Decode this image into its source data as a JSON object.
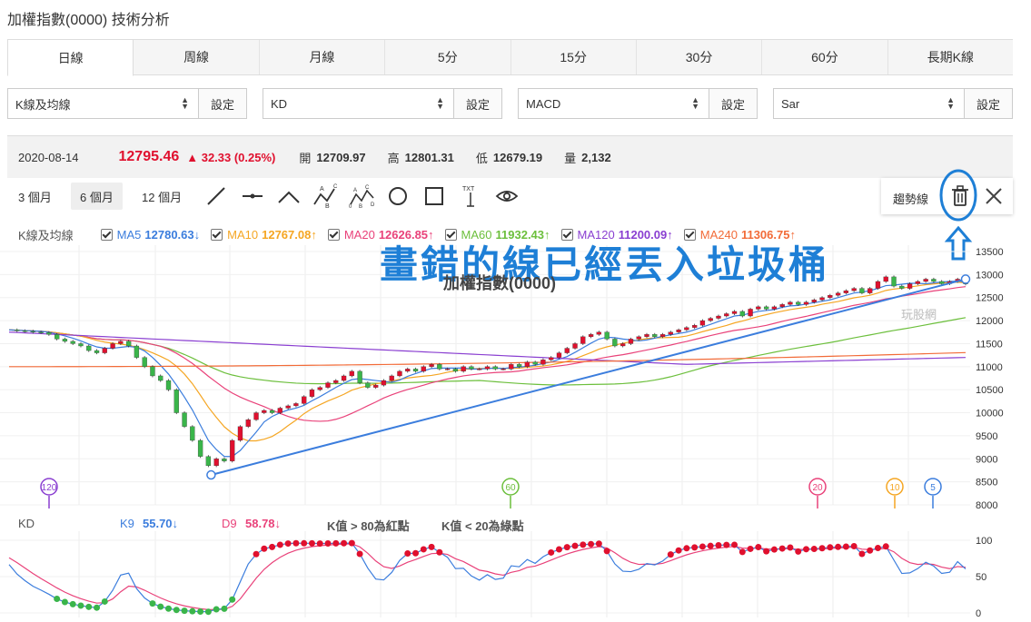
{
  "page_title": "加權指數(0000) 技術分析",
  "tabs": [
    "日線",
    "周線",
    "月線",
    "5分",
    "15分",
    "30分",
    "60分",
    "長期K線"
  ],
  "selectors": [
    {
      "value": "K線及均線",
      "button": "設定"
    },
    {
      "value": "KD",
      "button": "設定"
    },
    {
      "value": "MACD",
      "button": "設定"
    },
    {
      "value": "Sar",
      "button": "設定"
    }
  ],
  "info": {
    "date": "2020-08-14",
    "price": "12795.46",
    "change": "▲ 32.33 (0.25%)",
    "open_label": "開",
    "open": "12709.97",
    "high_label": "高",
    "high": "12801.31",
    "low_label": "低",
    "low": "12679.19",
    "vol_label": "量",
    "vol": "2,132"
  },
  "ranges": [
    "3 個月",
    "6 個月",
    "12 個月"
  ],
  "trend_label": "趨勢線",
  "main_legend": {
    "title": "K線及均線",
    "items": [
      {
        "label": "MA5",
        "value": "12780.63↓",
        "color": "#3b7ddd"
      },
      {
        "label": "MA10",
        "value": "12767.08↑",
        "color": "#f5a623"
      },
      {
        "label": "MA20",
        "value": "12626.85↑",
        "color": "#e9427a"
      },
      {
        "label": "MA60",
        "value": "11932.43↑",
        "color": "#6cbf3c"
      },
      {
        "label": "MA120",
        "value": "11200.09↑",
        "color": "#8a3fd1"
      },
      {
        "label": "MA240",
        "value": "11306.75↑",
        "color": "#f26b38"
      }
    ]
  },
  "annotation": "畫錯的線已經丟入垃圾桶",
  "chart_title": "加權指數(0000)",
  "watermark": "玩股網",
  "ma_markers": [
    {
      "label": "120",
      "color": "#8a3fd1"
    },
    {
      "label": "60",
      "color": "#6cbf3c"
    },
    {
      "label": "20",
      "color": "#e9427a"
    },
    {
      "label": "10",
      "color": "#f5a623"
    },
    {
      "label": "5",
      "color": "#3b7ddd"
    }
  ],
  "kd_legend": {
    "title": "KD",
    "k_label": "K9",
    "k_value": "55.70↓",
    "d_label": "D9",
    "d_value": "58.78↓",
    "note1": "K值 > 80為紅點",
    "note2": "K值 < 20為綠點"
  },
  "colors": {
    "up": "#e0102e",
    "down": "#3ab54a",
    "accent": "#1e7fd6"
  },
  "chart_data": {
    "type": "line",
    "y_ticks": [
      8000,
      8500,
      9000,
      9500,
      10000,
      10500,
      11000,
      11500,
      12000,
      12500,
      13000,
      13500
    ],
    "ylim": [
      8000,
      13500
    ],
    "n": 121,
    "close": [
      11800,
      11780,
      11770,
      11750,
      11740,
      11700,
      11600,
      11550,
      11500,
      11450,
      11350,
      11300,
      11400,
      11500,
      11550,
      11450,
      11200,
      11000,
      10800,
      10700,
      10500,
      10000,
      9700,
      9400,
      9050,
      8850,
      9000,
      8950,
      9400,
      9700,
      9850,
      10000,
      10050,
      10000,
      10100,
      10150,
      10200,
      10350,
      10500,
      10550,
      10650,
      10700,
      10800,
      10900,
      10650,
      10550,
      10600,
      10700,
      10800,
      10900,
      10950,
      10900,
      11000,
      11050,
      10950,
      10950,
      10900,
      11000,
      10950,
      10950,
      11000,
      10950,
      10950,
      11050,
      11000,
      11100,
      11050,
      11150,
      11200,
      11300,
      11400,
      11500,
      11650,
      11700,
      11750,
      11600,
      11450,
      11500,
      11600,
      11650,
      11700,
      11650,
      11700,
      11750,
      11800,
      11850,
      11900,
      12000,
      12050,
      12100,
      12150,
      12200,
      12100,
      12250,
      12300,
      12250,
      12300,
      12350,
      12400,
      12350,
      12400,
      12450,
      12500,
      12550,
      12600,
      12650,
      12700,
      12600,
      12700,
      12850,
      12950,
      12750,
      12700,
      12800,
      12850,
      12900,
      12850,
      12800,
      12850,
      12900,
      12795
    ],
    "trendline": [
      [
        25,
        8650
      ],
      [
        120,
        12900
      ]
    ],
    "kd_y_ticks": [
      0,
      50,
      100
    ]
  }
}
